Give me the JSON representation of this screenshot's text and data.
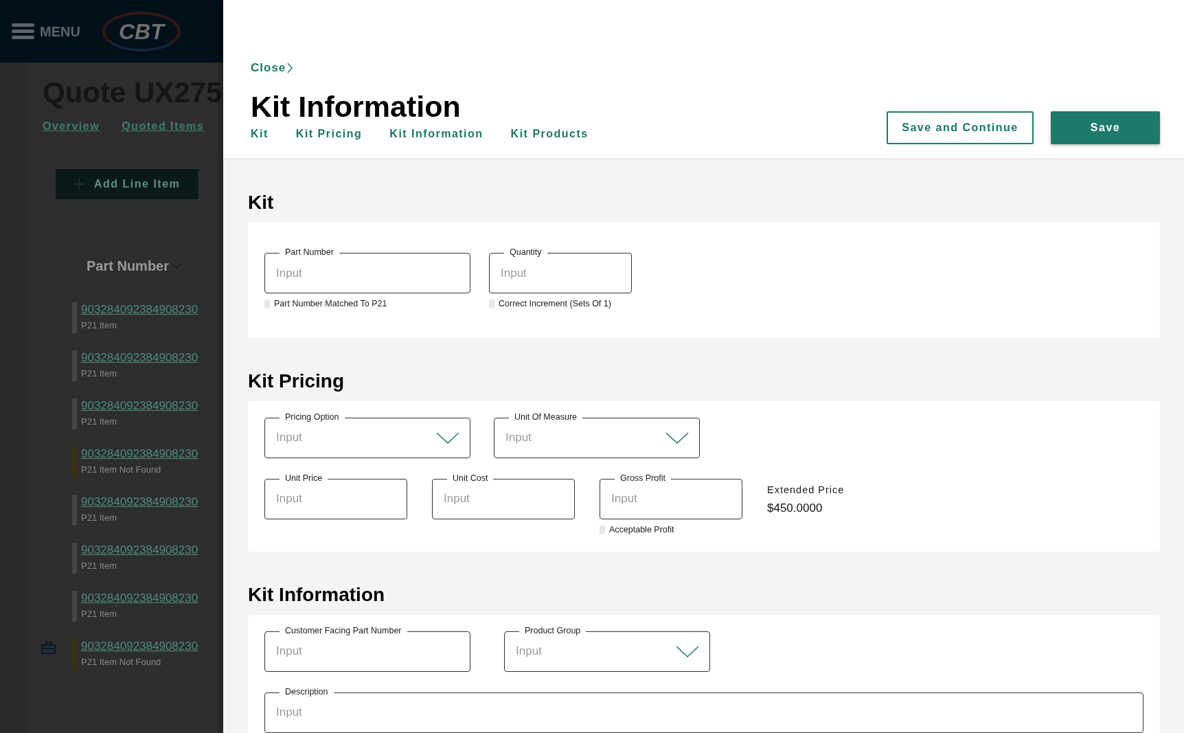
{
  "background_page": {
    "menu_label": "MENU",
    "logo": "CBT",
    "title": "Quote UX275",
    "tabs": [
      {
        "label": "Overview"
      },
      {
        "label": "Quoted Items"
      }
    ],
    "add_button": "Add Line Item",
    "column_header": "Part Number",
    "rows": [
      {
        "part_number": "903284092384908230",
        "status": "P21 Item",
        "color": "#474747",
        "kit": false
      },
      {
        "part_number": "903284092384908230",
        "status": "P21 Item",
        "color": "#474747",
        "kit": false
      },
      {
        "part_number": "903284092384908230",
        "status": "P21 Item",
        "color": "#474747",
        "kit": false
      },
      {
        "part_number": "903284092384908230",
        "status": "P21 Item Not Found",
        "color": "#3b3015",
        "kit": false
      },
      {
        "part_number": "903284092384908230",
        "status": "P21 Item",
        "color": "#474747",
        "kit": false
      },
      {
        "part_number": "903284092384908230",
        "status": "P21 Item",
        "color": "#474747",
        "kit": false
      },
      {
        "part_number": "903284092384908230",
        "status": "P21 Item",
        "color": "#474747",
        "kit": false
      },
      {
        "part_number": "903284092384908230",
        "status": "P21 Item Not Found",
        "color": "#3b3015",
        "kit": true
      }
    ]
  },
  "drawer": {
    "close": "Close",
    "title": "Kit Information",
    "tabs": [
      {
        "label": "Kit",
        "selected": false
      },
      {
        "label": "Kit Pricing",
        "selected": false
      },
      {
        "label": "Kit Information",
        "selected": false
      },
      {
        "label": "Kit Products",
        "selected": false
      }
    ],
    "buttons": [
      {
        "label": "Save and Continue",
        "kind": "outline"
      },
      {
        "label": "Save",
        "kind": "primary"
      }
    ],
    "sections": [
      {
        "title": "Kit",
        "rows": [
          [
            {
              "kind": "text",
              "label": "Part Number",
              "placeholder": "Input",
              "check": {
                "label": "Part Number Matched To P21",
                "checked": false
              }
            },
            {
              "kind": "text",
              "label": "Quantity",
              "placeholder": "Input",
              "check": {
                "label": "Correct Increment (Sets Of 1)",
                "checked": false
              }
            }
          ]
        ]
      },
      {
        "title": "Kit Pricing",
        "rows": [
          [
            {
              "kind": "select",
              "label": "Pricing Option",
              "placeholder": "Input"
            },
            {
              "kind": "select",
              "label": "Unit Of Measure",
              "placeholder": "Input"
            }
          ],
          [
            {
              "kind": "text",
              "label": "Unit Price",
              "placeholder": "Input"
            },
            {
              "kind": "text",
              "label": "Unit Cost",
              "placeholder": "Input"
            },
            {
              "kind": "text",
              "label": "Gross Profit",
              "placeholder": "Input",
              "check": {
                "label": "Acceptable Profit",
                "checked": false
              }
            },
            {
              "kind": "readout",
              "label": "Extended Price",
              "value": "$450.0000"
            }
          ]
        ]
      },
      {
        "title": "Kit Information",
        "rows": [
          [
            {
              "kind": "text",
              "label": "Customer Facing Part Number",
              "placeholder": "Input"
            },
            {
              "kind": "select",
              "label": "Product Group",
              "placeholder": "Input"
            }
          ],
          [
            {
              "kind": "text",
              "label": "Description",
              "placeholder": "Input"
            }
          ]
        ]
      }
    ]
  }
}
